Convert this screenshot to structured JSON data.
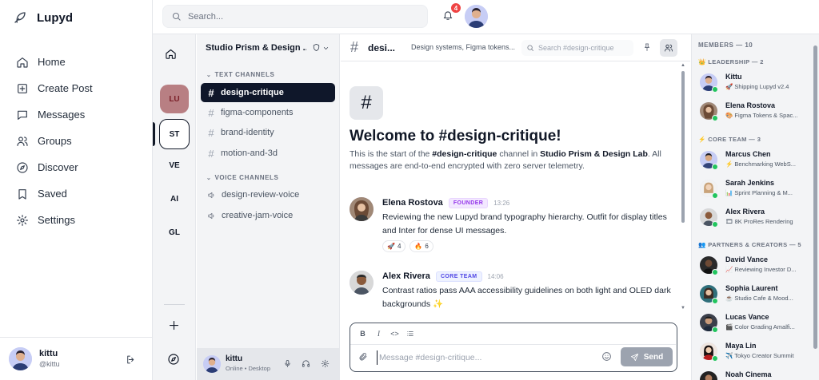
{
  "app": {
    "name": "Lupyd"
  },
  "nav": {
    "items": [
      {
        "label": "Home",
        "icon": "home-icon"
      },
      {
        "label": "Create Post",
        "icon": "plus-square-icon"
      },
      {
        "label": "Messages",
        "icon": "message-icon"
      },
      {
        "label": "Groups",
        "icon": "users-icon"
      },
      {
        "label": "Discover",
        "icon": "compass-icon"
      },
      {
        "label": "Saved",
        "icon": "bookmark-icon"
      },
      {
        "label": "Settings",
        "icon": "gear-icon"
      }
    ]
  },
  "user": {
    "name": "kittu",
    "handle": "@kittu",
    "status": "Online • Desktop"
  },
  "header": {
    "search_placeholder": "Search...",
    "notification_count": "4"
  },
  "servers": [
    "LU",
    "ST",
    "VE",
    "AI",
    "GL"
  ],
  "server": {
    "name": "Studio Prism & Design ...",
    "text_section": "TEXT CHANNELS",
    "voice_section": "VOICE CHANNELS",
    "text_channels": [
      "design-critique",
      "figma-components",
      "brand-identity",
      "motion-and-3d"
    ],
    "voice_channels": [
      "design-review-voice",
      "creative-jam-voice"
    ]
  },
  "channel": {
    "hash": "#",
    "name": "desi...",
    "topic": "Design systems, Figma tokens...",
    "search_placeholder": "Search #design-critique",
    "welcome": "Welcome to #design-critique!",
    "intro_start": "This is the start of the ",
    "intro_channel": "#design-critique",
    "intro_mid": " channel in ",
    "intro_server": "Studio Prism & Design Lab",
    "intro_end": ". All messages are end-to-end encrypted with zero server telemetry."
  },
  "messages": [
    {
      "author": "Elena Rostova",
      "role": "FOUNDER",
      "time": "13:26",
      "text": "Reviewing the new Lupyd brand typography hierarchy. Outfit for display titles and Inter for dense UI messages.",
      "reactions": [
        {
          "emoji": "🚀",
          "count": "4"
        },
        {
          "emoji": "🔥",
          "count": "6"
        }
      ]
    },
    {
      "author": "Alex Rivera",
      "role": "CORE TEAM",
      "time": "14:06",
      "text": "Contrast ratios pass AAA accessibility guidelines on both light and OLED dark backgrounds ✨"
    }
  ],
  "composer": {
    "placeholder": "Message #design-critique...",
    "send_label": "Send",
    "bold": "B",
    "italic": "I",
    "code": "<>"
  },
  "members": {
    "title": "MEMBERS — 10",
    "sections": [
      {
        "label": "👑 LEADERSHIP — 2",
        "people": [
          {
            "name": "Kittu",
            "status": "🚀 Shipping Lupyd v2.4"
          },
          {
            "name": "Elena Rostova",
            "status": "🎨 Figma Tokens & Spac..."
          }
        ]
      },
      {
        "label": "⚡ CORE TEAM — 3",
        "people": [
          {
            "name": "Marcus Chen",
            "status": "⚡ Benchmarking WebS..."
          },
          {
            "name": "Sarah Jenkins",
            "status": "📊 Sprint Planning & M..."
          },
          {
            "name": "Alex Rivera",
            "status": "🎞 8K ProRes Rendering"
          }
        ]
      },
      {
        "label": "👥 PARTNERS & CREATORS — 5",
        "people": [
          {
            "name": "David Vance",
            "status": "📈 Reviewing Investor D..."
          },
          {
            "name": "Sophia Laurent",
            "status": "☕ Studio Cafe & Mood..."
          },
          {
            "name": "Lucas Vance",
            "status": "🎬 Color Grading Amalfi..."
          },
          {
            "name": "Maya Lin",
            "status": "✈️ Tokyo Creator Summit"
          },
          {
            "name": "Noah Cinema",
            "status": ""
          }
        ]
      }
    ]
  },
  "colors": {
    "accent": "#0f172a",
    "badge": "#ef4444",
    "online": "#22c55e",
    "founder": "#9333ea",
    "core": "#4f46e5"
  }
}
